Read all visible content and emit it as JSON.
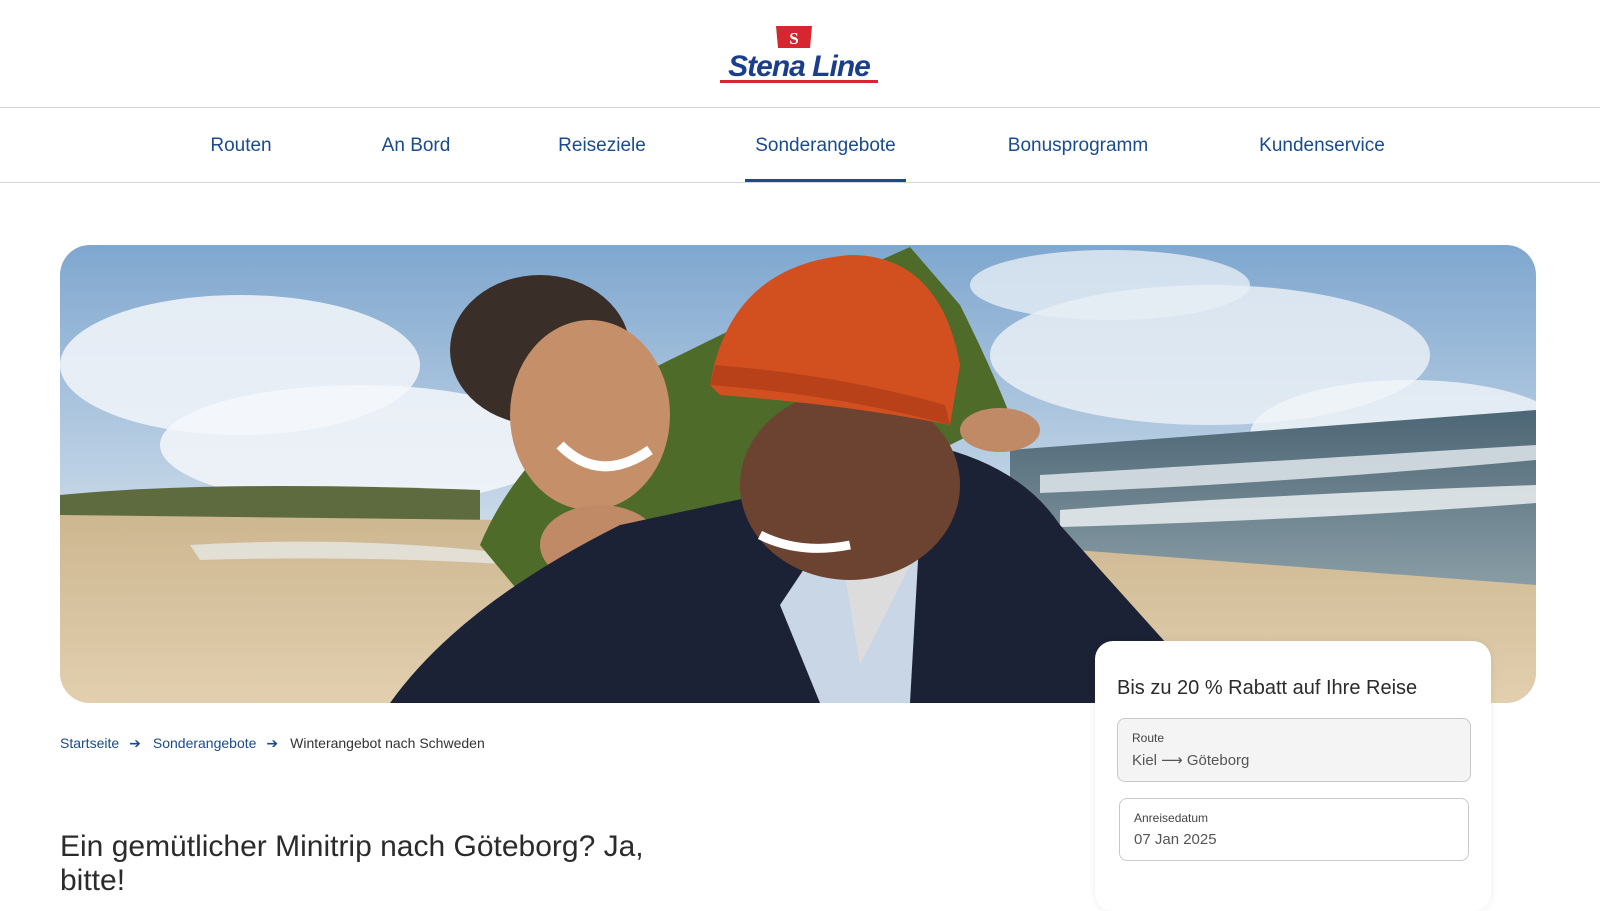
{
  "brand": {
    "flag_letter": "S",
    "name": "Stena Line",
    "colors": {
      "navy": "#1a3e8c",
      "red": "#d7262f",
      "link": "#1a4b8c"
    }
  },
  "nav": {
    "items": [
      {
        "label": "Routen"
      },
      {
        "label": "An Bord"
      },
      {
        "label": "Reiseziele"
      },
      {
        "label": "Sonderangebote",
        "active": true
      },
      {
        "label": "Bonusprogramm"
      },
      {
        "label": "Kundenservice"
      }
    ]
  },
  "breadcrumb": {
    "items": [
      "Startseite",
      "Sonderangebote"
    ],
    "current": "Winterangebot nach Schweden",
    "separator_icon": "arrow-right-icon"
  },
  "main": {
    "title": "Ein gemütlicher Minitrip nach Göteborg? Ja, bitte!"
  },
  "offer": {
    "title": "Bis zu 20 % Rabatt auf Ihre Reise",
    "route": {
      "label": "Route",
      "value": "Kiel ⟶ Göteborg"
    },
    "date": {
      "label": "Anreisedatum",
      "value": "07 Jan 2025"
    }
  }
}
